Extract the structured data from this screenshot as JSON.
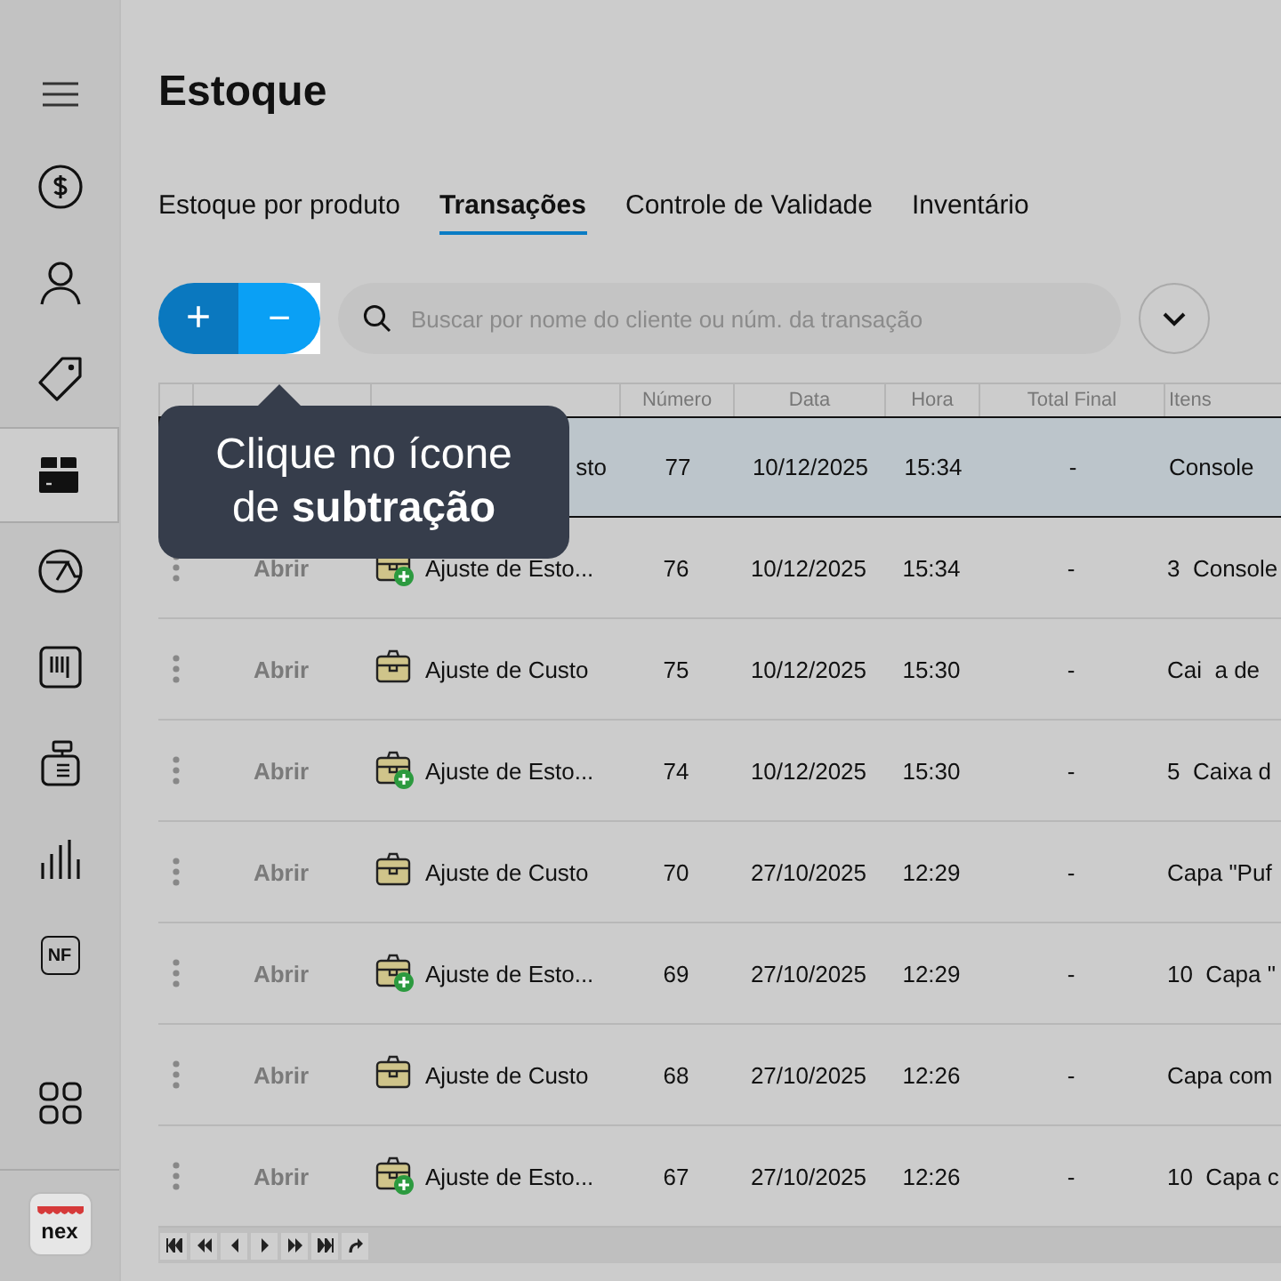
{
  "sidebar": {
    "items": [
      {
        "kind": "menu",
        "selected": false
      },
      {
        "kind": "dollar",
        "selected": false
      },
      {
        "kind": "person",
        "selected": false
      },
      {
        "kind": "tag",
        "selected": false
      },
      {
        "kind": "box",
        "selected": true
      },
      {
        "kind": "gauge",
        "selected": false
      },
      {
        "kind": "barcode",
        "selected": false
      },
      {
        "kind": "register",
        "selected": false
      },
      {
        "kind": "chart",
        "selected": false
      },
      {
        "kind": "nf",
        "label": "NF",
        "selected": false
      },
      {
        "kind": "grid",
        "selected": false
      }
    ],
    "logo": "nex"
  },
  "page": {
    "title": "Estoque"
  },
  "tabs": [
    {
      "label": "Estoque por produto",
      "selected": false
    },
    {
      "label": "Transações",
      "selected": true
    },
    {
      "label": "Controle de Validade",
      "selected": false
    },
    {
      "label": "Inventário",
      "selected": false
    }
  ],
  "toolbar": {
    "add_symbol": "+",
    "subtract_symbol": "−",
    "search": {
      "placeholder": "Buscar por nome do cliente ou núm. da transação"
    }
  },
  "tooltip": {
    "text": "Clique no ícone de **subtração**"
  },
  "table": {
    "columns": [
      "",
      "",
      "",
      "Número",
      "Data",
      "Hora",
      "Total Final",
      "Itens"
    ],
    "rows": [
      {
        "selected": true,
        "action": "",
        "kind": "none",
        "type": "sto",
        "number": "77",
        "date": "10/12/2025",
        "time": "15:34",
        "total": "-",
        "items": "Console"
      },
      {
        "selected": false,
        "action": "Abrir",
        "kind": "stock",
        "type": "Ajuste de Esto...",
        "number": "76",
        "date": "10/12/2025",
        "time": "15:34",
        "total": "-",
        "items": "3  Console"
      },
      {
        "selected": false,
        "action": "Abrir",
        "kind": "cost",
        "type": "Ajuste de Custo",
        "number": "75",
        "date": "10/12/2025",
        "time": "15:30",
        "total": "-",
        "items": "Cai  a de"
      },
      {
        "selected": false,
        "action": "Abrir",
        "kind": "stock",
        "type": "Ajuste de Esto...",
        "number": "74",
        "date": "10/12/2025",
        "time": "15:30",
        "total": "-",
        "items": "5  Caixa d"
      },
      {
        "selected": false,
        "action": "Abrir",
        "kind": "cost",
        "type": "Ajuste de Custo",
        "number": "70",
        "date": "27/10/2025",
        "time": "12:29",
        "total": "-",
        "items": "Capa \"Puf"
      },
      {
        "selected": false,
        "action": "Abrir",
        "kind": "stock",
        "type": "Ajuste de Esto...",
        "number": "69",
        "date": "27/10/2025",
        "time": "12:29",
        "total": "-",
        "items": "10  Capa \""
      },
      {
        "selected": false,
        "action": "Abrir",
        "kind": "cost",
        "type": "Ajuste de Custo",
        "number": "68",
        "date": "27/10/2025",
        "time": "12:26",
        "total": "-",
        "items": "Capa com"
      },
      {
        "selected": false,
        "action": "Abrir",
        "kind": "stock",
        "type": "Ajuste de Esto...",
        "number": "67",
        "date": "27/10/2025",
        "time": "12:26",
        "total": "-",
        "items": "10  Capa c"
      }
    ]
  },
  "pager": {
    "buttons": [
      {
        "kind": "first"
      },
      {
        "kind": "prev-page"
      },
      {
        "kind": "prev"
      },
      {
        "kind": "next"
      },
      {
        "kind": "next-page"
      },
      {
        "kind": "last"
      },
      {
        "kind": "refresh"
      }
    ]
  }
}
